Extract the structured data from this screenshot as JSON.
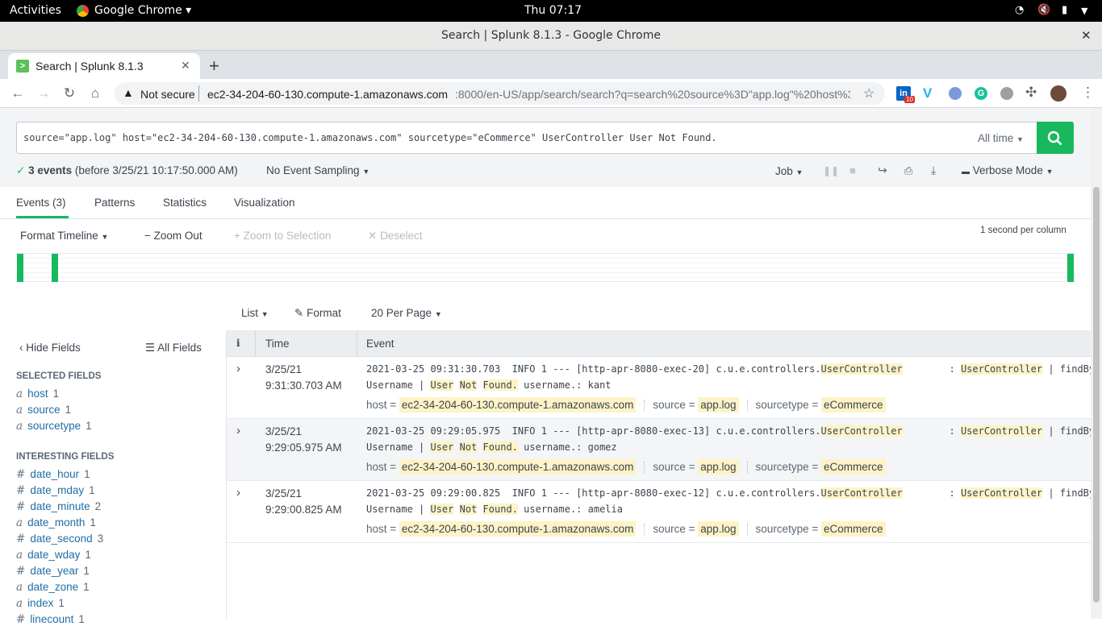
{
  "gnome": {
    "activities": "Activities",
    "app": "Google Chrome",
    "clock": "Thu 07:17"
  },
  "window": {
    "title": "Search | Splunk 8.1.3 - Google Chrome"
  },
  "browser": {
    "tab_title": "Search | Splunk 8.1.3",
    "security": "Not secure",
    "url_host": "ec2-34-204-60-130.compute-1.amazonaws.com",
    "url_rest": ":8000/en-US/app/search/search?q=search%20source%3D\"app.log\"%20host%3...",
    "ext_badge": "10"
  },
  "search": {
    "query": "source=\"app.log\" host=\"ec2-34-204-60-130.compute-1.amazonaws.com\" sourcetype=\"eCommerce\" UserController User Not Found.",
    "time_range": "All time"
  },
  "status": {
    "events_bold": "3 events",
    "events_rest": "(before 3/25/21 10:17:50.000 AM)",
    "sampling": "No Event Sampling",
    "job": "Job",
    "mode": "Verbose Mode"
  },
  "tabs": [
    "Events (3)",
    "Patterns",
    "Statistics",
    "Visualization"
  ],
  "timeline": {
    "format": "Format Timeline",
    "zoom_out": "Zoom Out",
    "zoom_sel": "+ Zoom to Selection",
    "deselect": "Deselect",
    "scale": "1 second per column"
  },
  "listbar": {
    "list": "List",
    "format": "Format",
    "per_page": "20 Per Page"
  },
  "sidebar": {
    "hide": "Hide Fields",
    "all": "All Fields",
    "selected_title": "SELECTED FIELDS",
    "selected": [
      {
        "type": "a",
        "name": "host",
        "count": "1"
      },
      {
        "type": "a",
        "name": "source",
        "count": "1"
      },
      {
        "type": "a",
        "name": "sourcetype",
        "count": "1"
      }
    ],
    "interesting_title": "INTERESTING FIELDS",
    "interesting": [
      {
        "type": "#",
        "name": "date_hour",
        "count": "1"
      },
      {
        "type": "#",
        "name": "date_mday",
        "count": "1"
      },
      {
        "type": "#",
        "name": "date_minute",
        "count": "2"
      },
      {
        "type": "a",
        "name": "date_month",
        "count": "1"
      },
      {
        "type": "#",
        "name": "date_second",
        "count": "3"
      },
      {
        "type": "a",
        "name": "date_wday",
        "count": "1"
      },
      {
        "type": "#",
        "name": "date_year",
        "count": "1"
      },
      {
        "type": "a",
        "name": "date_zone",
        "count": "1"
      },
      {
        "type": "a",
        "name": "index",
        "count": "1"
      },
      {
        "type": "#",
        "name": "linecount",
        "count": "1"
      }
    ]
  },
  "table": {
    "col_info": "i",
    "col_time": "Time",
    "col_event": "Event",
    "host_label": "host =",
    "source_label": "source =",
    "sourcetype_label": "sourcetype =",
    "rows": [
      {
        "date": "3/25/21",
        "time": "9:31:30.703 AM",
        "prefix": "2021-03-25 09:31:30.703  INFO 1 --- [http-apr-8080-exec-20] c.u.e.controllers.",
        "user": "kant",
        "host": "ec2-34-204-60-130.compute-1.amazonaws.com",
        "source": "app.log",
        "sourcetype": "eCommerce"
      },
      {
        "date": "3/25/21",
        "time": "9:29:05.975 AM",
        "prefix": "2021-03-25 09:29:05.975  INFO 1 --- [http-apr-8080-exec-13] c.u.e.controllers.",
        "user": "gomez",
        "host": "ec2-34-204-60-130.compute-1.amazonaws.com",
        "source": "app.log",
        "sourcetype": "eCommerce"
      },
      {
        "date": "3/25/21",
        "time": "9:29:00.825 AM",
        "prefix": "2021-03-25 09:29:00.825  INFO 1 --- [http-apr-8080-exec-12] c.u.e.controllers.",
        "user": "amelia",
        "host": "ec2-34-204-60-130.compute-1.amazonaws.com",
        "source": "app.log",
        "sourcetype": "eCommerce"
      }
    ],
    "kw_controller": "UserController",
    "kw_findby": "| findBy",
    "kw_username": "Username |",
    "kw_user": "User",
    "kw_not": "Not",
    "kw_found": "Found.",
    "kw_username_label": "username.:"
  },
  "colors": {
    "accent": "#1ab85e",
    "link": "#1e6ea6",
    "highlight": "#fdf3c7"
  }
}
